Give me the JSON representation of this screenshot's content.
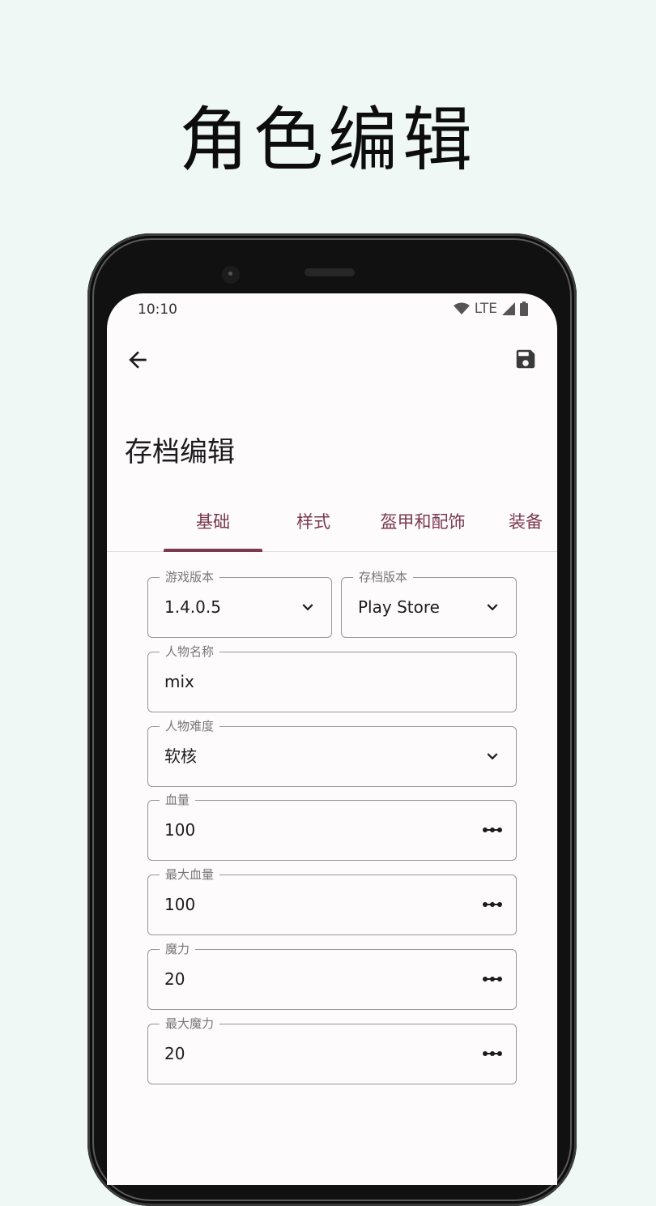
{
  "promo": {
    "title": "角色编辑"
  },
  "status_bar": {
    "time": "10:10",
    "network": "LTE"
  },
  "app_bar": {
    "back_icon": "arrow-back-icon",
    "save_icon": "save-floppy-icon"
  },
  "page": {
    "title": "存档编辑"
  },
  "tabs": [
    {
      "label": "基础",
      "active": true
    },
    {
      "label": "样式",
      "active": false
    },
    {
      "label": "盔甲和配饰",
      "active": false
    },
    {
      "label": "装备",
      "active": false
    }
  ],
  "form": {
    "game_version": {
      "label": "游戏版本",
      "value": "1.4.0.5",
      "icon": "chevron-down-icon"
    },
    "save_version": {
      "label": "存档版本",
      "value": "Play Store",
      "icon": "chevron-down-icon"
    },
    "character_name": {
      "label": "人物名称",
      "value": "mix"
    },
    "difficulty": {
      "label": "人物难度",
      "value": "软核",
      "icon": "chevron-down-icon"
    },
    "health": {
      "label": "血量",
      "value": "100",
      "icon": "more-dots-icon"
    },
    "max_health": {
      "label": "最大血量",
      "value": "100",
      "icon": "more-dots-icon"
    },
    "mana": {
      "label": "魔力",
      "value": "20",
      "icon": "more-dots-icon"
    },
    "max_mana": {
      "label": "最大魔力",
      "value": "20",
      "icon": "more-dots-icon"
    }
  },
  "colors": {
    "accent": "#7d3a4f",
    "background": "#eff8f4",
    "surface": "#fefbfc"
  }
}
